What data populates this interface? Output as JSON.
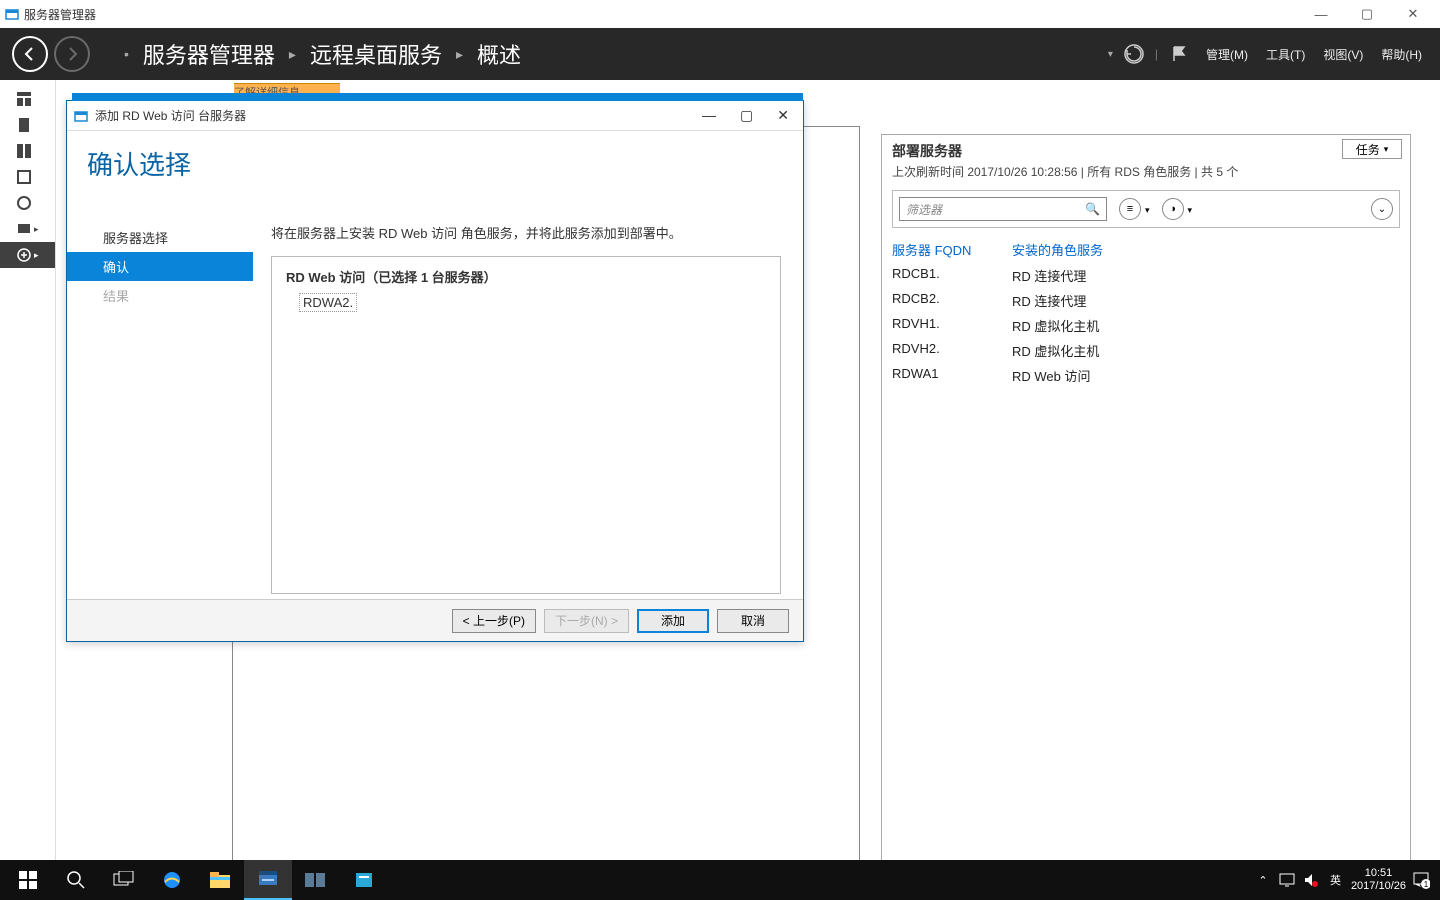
{
  "window": {
    "title": "服务器管理器"
  },
  "header": {
    "crumb1": "服务器管理器",
    "crumb2": "远程桌面服务",
    "crumb3": "概述",
    "menu": {
      "manage": "管理(M)",
      "tools": "工具(T)",
      "view": "视图(V)",
      "help": "帮助(H)"
    }
  },
  "notice": "了解详细信息",
  "dialog": {
    "title": "添加 RD Web 访问 台服务器",
    "heading": "确认选择",
    "nav": {
      "step1": "服务器选择",
      "step2": "确认",
      "step3": "结果"
    },
    "desc": "将在服务器上安装 RD Web 访问 角色服务，并将此服务添加到部署中。",
    "list_head": "RD Web 访问（已选择 1 台服务器）",
    "selected_server": "RDWA2.",
    "buttons": {
      "prev": "< 上一步(P)",
      "next": "下一步(N) >",
      "add": "添加",
      "cancel": "取消"
    }
  },
  "servers": {
    "title": "部署服务器",
    "subtitle": "上次刷新时间 2017/10/26 10:28:56 | 所有 RDS 角色服务 | 共 5 个",
    "tasks": "任务",
    "filter_placeholder": "筛选器",
    "col1": "服务器 FQDN",
    "col2": "安装的角色服务",
    "rows": [
      {
        "fqdn": "RDCB1.",
        "role": "RD 连接代理"
      },
      {
        "fqdn": "RDCB2.",
        "role": "RD 连接代理"
      },
      {
        "fqdn": "RDVH1.",
        "role": "RD 虚拟化主机"
      },
      {
        "fqdn": "RDVH2.",
        "role": "RD 虚拟化主机"
      },
      {
        "fqdn": "RDWA1",
        "role": "RD Web 访问"
      }
    ]
  },
  "taskbar": {
    "ime": "英",
    "time": "10:51",
    "date": "2017/10/26"
  }
}
